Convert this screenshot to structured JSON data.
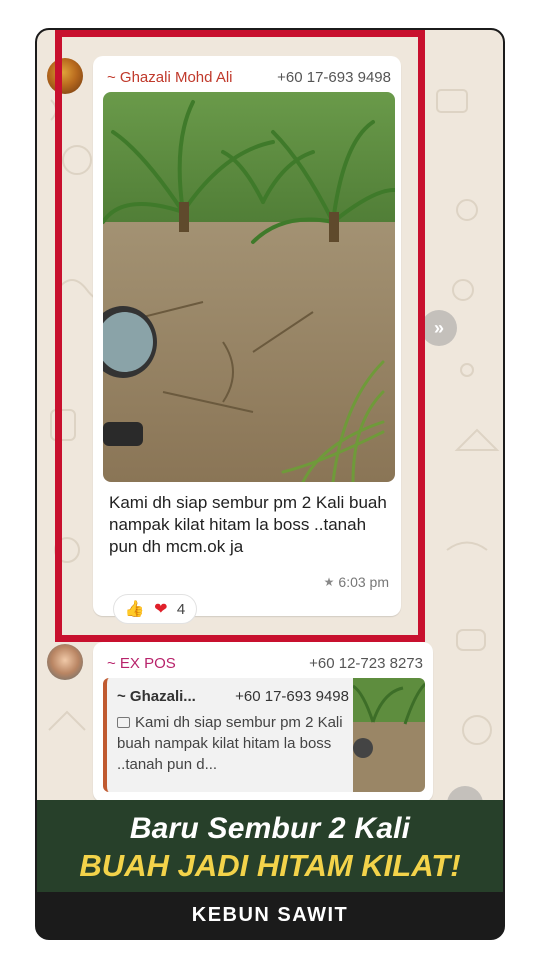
{
  "colors": {
    "highlight_frame": "#c8102e",
    "sender_1": "#c0392b",
    "sender_2": "#b8236b",
    "banner_bg": "#27402a",
    "headline_white": "#ffffff",
    "headline_yellow": "#f3d34a",
    "footer_bg": "#1b1b1b"
  },
  "message_1": {
    "sender_name": "~ Ghazali Mohd Ali",
    "sender_phone": "+60 17-693 9498",
    "text": "Kami dh siap sembur pm 2 Kali buah nampak kilat hitam la boss ..tanah pun dh mcm.ok ja",
    "time": "6:03 pm",
    "starred_icon": "star-icon",
    "reactions": {
      "emojis": "👍❤️",
      "count": "4"
    }
  },
  "message_2": {
    "sender_name": "~ EX POS",
    "sender_phone": "+60 12-723 8273",
    "quoted": {
      "name": "~ Ghazali...",
      "phone": "+60 17-693 9498",
      "text": "Kami dh siap sembur pm 2 Kali buah nampak kilat hitam la boss ..tanah pun d..."
    }
  },
  "banner": {
    "line_1": "Baru Sembur 2 Kali",
    "line_2": "BUAH JADI HITAM KILAT!"
  },
  "footer": {
    "label": "KEBUN SAWIT"
  }
}
